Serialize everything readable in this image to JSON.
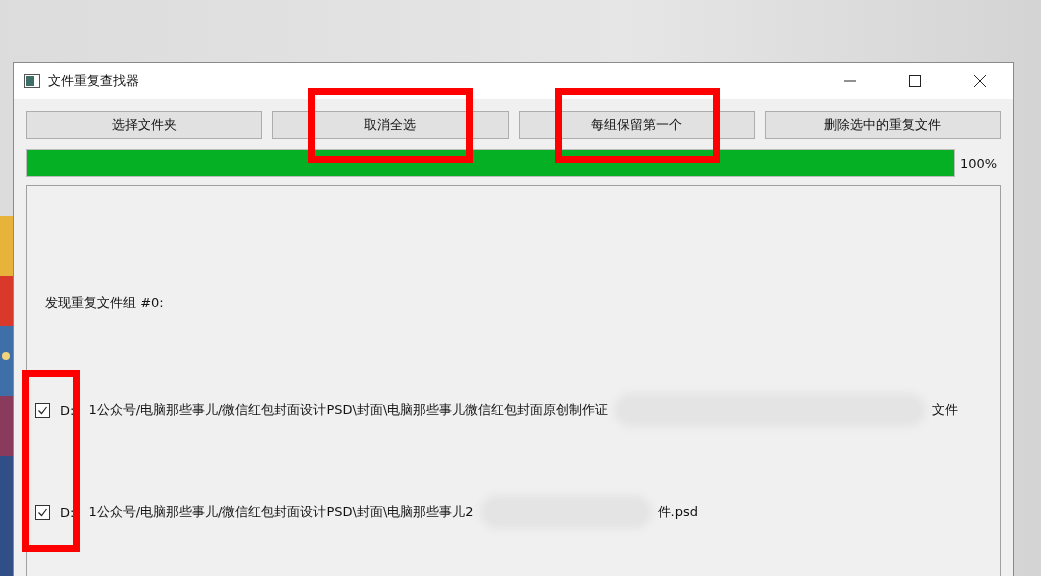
{
  "window": {
    "title": "文件重复查找器"
  },
  "buttons": [
    {
      "label": "选择文件夹",
      "highlighted": false
    },
    {
      "label": "取消全选",
      "highlighted": true
    },
    {
      "label": "每组保留第一个",
      "highlighted": true
    },
    {
      "label": "删除选中的重复文件",
      "highlighted": false
    }
  ],
  "progress": {
    "level": 1,
    "reading": "100%"
  },
  "results": {
    "group_label": "发现重复文件组 #0:",
    "checkboxes_highlighted": true,
    "files": [
      {
        "checked": true,
        "drive": "D:",
        "path_start": "1公众号/电脑那些事儿/微信红包封面设计PSD\\封面\\电脑那些事儿微信红包封面原创制作证",
        "path_end": "文件"
      },
      {
        "checked": true,
        "drive": "D:",
        "path_start": "1公众号/电脑那些事儿/微信红包封面设计PSD\\封面\\电脑那些事儿2",
        "path_end": "件.psd"
      }
    ]
  }
}
